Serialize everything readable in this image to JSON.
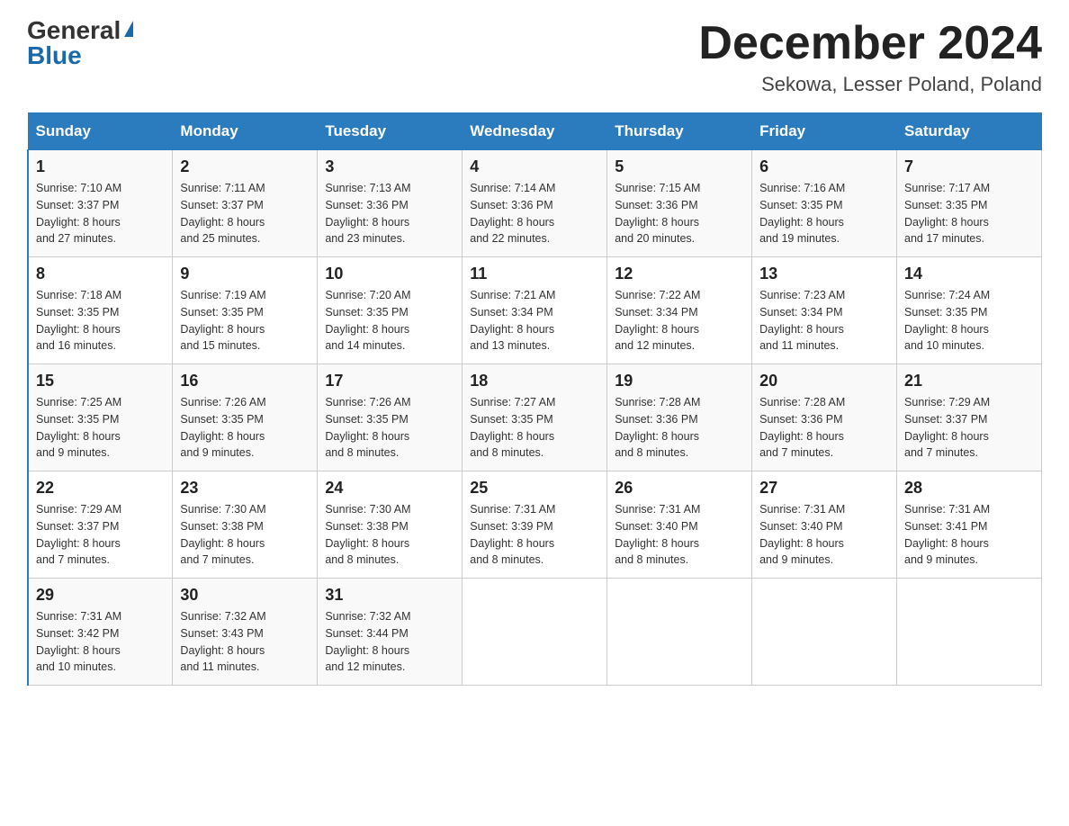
{
  "logo": {
    "general": "General",
    "blue": "Blue"
  },
  "title": "December 2024",
  "subtitle": "Sekowa, Lesser Poland, Poland",
  "headers": [
    "Sunday",
    "Monday",
    "Tuesday",
    "Wednesday",
    "Thursday",
    "Friday",
    "Saturday"
  ],
  "weeks": [
    [
      {
        "day": "1",
        "sunrise": "7:10 AM",
        "sunset": "3:37 PM",
        "daylight": "8 hours and 27 minutes."
      },
      {
        "day": "2",
        "sunrise": "7:11 AM",
        "sunset": "3:37 PM",
        "daylight": "8 hours and 25 minutes."
      },
      {
        "day": "3",
        "sunrise": "7:13 AM",
        "sunset": "3:36 PM",
        "daylight": "8 hours and 23 minutes."
      },
      {
        "day": "4",
        "sunrise": "7:14 AM",
        "sunset": "3:36 PM",
        "daylight": "8 hours and 22 minutes."
      },
      {
        "day": "5",
        "sunrise": "7:15 AM",
        "sunset": "3:36 PM",
        "daylight": "8 hours and 20 minutes."
      },
      {
        "day": "6",
        "sunrise": "7:16 AM",
        "sunset": "3:35 PM",
        "daylight": "8 hours and 19 minutes."
      },
      {
        "day": "7",
        "sunrise": "7:17 AM",
        "sunset": "3:35 PM",
        "daylight": "8 hours and 17 minutes."
      }
    ],
    [
      {
        "day": "8",
        "sunrise": "7:18 AM",
        "sunset": "3:35 PM",
        "daylight": "8 hours and 16 minutes."
      },
      {
        "day": "9",
        "sunrise": "7:19 AM",
        "sunset": "3:35 PM",
        "daylight": "8 hours and 15 minutes."
      },
      {
        "day": "10",
        "sunrise": "7:20 AM",
        "sunset": "3:35 PM",
        "daylight": "8 hours and 14 minutes."
      },
      {
        "day": "11",
        "sunrise": "7:21 AM",
        "sunset": "3:34 PM",
        "daylight": "8 hours and 13 minutes."
      },
      {
        "day": "12",
        "sunrise": "7:22 AM",
        "sunset": "3:34 PM",
        "daylight": "8 hours and 12 minutes."
      },
      {
        "day": "13",
        "sunrise": "7:23 AM",
        "sunset": "3:34 PM",
        "daylight": "8 hours and 11 minutes."
      },
      {
        "day": "14",
        "sunrise": "7:24 AM",
        "sunset": "3:35 PM",
        "daylight": "8 hours and 10 minutes."
      }
    ],
    [
      {
        "day": "15",
        "sunrise": "7:25 AM",
        "sunset": "3:35 PM",
        "daylight": "8 hours and 9 minutes."
      },
      {
        "day": "16",
        "sunrise": "7:26 AM",
        "sunset": "3:35 PM",
        "daylight": "8 hours and 9 minutes."
      },
      {
        "day": "17",
        "sunrise": "7:26 AM",
        "sunset": "3:35 PM",
        "daylight": "8 hours and 8 minutes."
      },
      {
        "day": "18",
        "sunrise": "7:27 AM",
        "sunset": "3:35 PM",
        "daylight": "8 hours and 8 minutes."
      },
      {
        "day": "19",
        "sunrise": "7:28 AM",
        "sunset": "3:36 PM",
        "daylight": "8 hours and 8 minutes."
      },
      {
        "day": "20",
        "sunrise": "7:28 AM",
        "sunset": "3:36 PM",
        "daylight": "8 hours and 7 minutes."
      },
      {
        "day": "21",
        "sunrise": "7:29 AM",
        "sunset": "3:37 PM",
        "daylight": "8 hours and 7 minutes."
      }
    ],
    [
      {
        "day": "22",
        "sunrise": "7:29 AM",
        "sunset": "3:37 PM",
        "daylight": "8 hours and 7 minutes."
      },
      {
        "day": "23",
        "sunrise": "7:30 AM",
        "sunset": "3:38 PM",
        "daylight": "8 hours and 7 minutes."
      },
      {
        "day": "24",
        "sunrise": "7:30 AM",
        "sunset": "3:38 PM",
        "daylight": "8 hours and 8 minutes."
      },
      {
        "day": "25",
        "sunrise": "7:31 AM",
        "sunset": "3:39 PM",
        "daylight": "8 hours and 8 minutes."
      },
      {
        "day": "26",
        "sunrise": "7:31 AM",
        "sunset": "3:40 PM",
        "daylight": "8 hours and 8 minutes."
      },
      {
        "day": "27",
        "sunrise": "7:31 AM",
        "sunset": "3:40 PM",
        "daylight": "8 hours and 9 minutes."
      },
      {
        "day": "28",
        "sunrise": "7:31 AM",
        "sunset": "3:41 PM",
        "daylight": "8 hours and 9 minutes."
      }
    ],
    [
      {
        "day": "29",
        "sunrise": "7:31 AM",
        "sunset": "3:42 PM",
        "daylight": "8 hours and 10 minutes."
      },
      {
        "day": "30",
        "sunrise": "7:32 AM",
        "sunset": "3:43 PM",
        "daylight": "8 hours and 11 minutes."
      },
      {
        "day": "31",
        "sunrise": "7:32 AM",
        "sunset": "3:44 PM",
        "daylight": "8 hours and 12 minutes."
      },
      null,
      null,
      null,
      null
    ]
  ],
  "labels": {
    "sunrise": "Sunrise:",
    "sunset": "Sunset:",
    "daylight": "Daylight:"
  }
}
